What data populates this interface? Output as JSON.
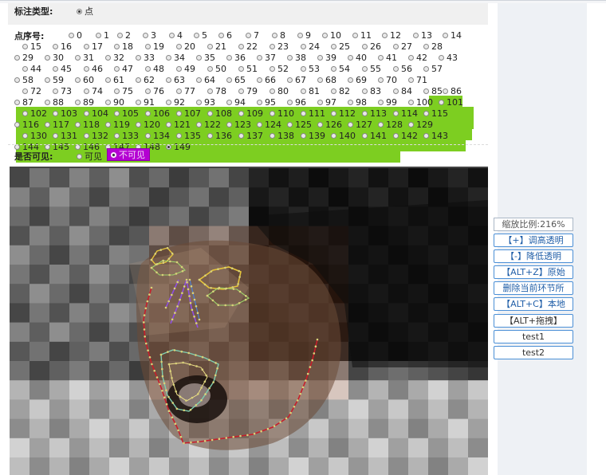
{
  "annotation_type": {
    "label": "标注类型:",
    "options": [
      "点"
    ],
    "selected": "点"
  },
  "point_order": {
    "label": "点序号:",
    "selected": "149",
    "highlight_color": "#7dce21",
    "points": [
      "0",
      "1",
      "2",
      "3",
      "4",
      "5",
      "6",
      "7",
      "8",
      "9",
      "10",
      "11",
      "12",
      "13",
      "14",
      "15",
      "16",
      "17",
      "18",
      "19",
      "20",
      "21",
      "22",
      "23",
      "24",
      "25",
      "26",
      "27",
      "28",
      "29",
      "30",
      "31",
      "32",
      "33",
      "34",
      "35",
      "36",
      "37",
      "38",
      "39",
      "40",
      "41",
      "42",
      "43",
      "44",
      "45",
      "46",
      "47",
      "48",
      "49",
      "50",
      "51",
      "52",
      "53",
      "54",
      "55",
      "56",
      "57",
      "58",
      "59",
      "60",
      "61",
      "62",
      "63",
      "64",
      "65",
      "66",
      "67",
      "68",
      "69",
      "70",
      "71",
      "72",
      "73",
      "74",
      "75",
      "76",
      "77",
      "78",
      "79",
      "80",
      "81",
      "82",
      "83",
      "84",
      "85",
      "86",
      "87",
      "88",
      "89",
      "90",
      "91",
      "92",
      "93",
      "94",
      "95",
      "96",
      "97",
      "98",
      "99",
      "100",
      "101",
      "102",
      "103",
      "104",
      "105",
      "106",
      "107",
      "108",
      "109",
      "110",
      "111",
      "112",
      "113",
      "114",
      "115",
      "116",
      "117",
      "118",
      "119",
      "120",
      "121",
      "122",
      "123",
      "124",
      "125",
      "126",
      "127",
      "128",
      "129",
      "130",
      "131",
      "132",
      "133",
      "134",
      "135",
      "136",
      "137",
      "138",
      "139",
      "140",
      "141",
      "142",
      "143",
      "144",
      "145",
      "146",
      "147",
      "148",
      "149"
    ]
  },
  "visibility": {
    "label": "是否可见:",
    "visible_label": "可见",
    "invisible_label": "不可见",
    "selected": "不可见",
    "selected_color": "#b400d2"
  },
  "viewer": {
    "image": "pixelated face photo with facial landmark annotations"
  },
  "side_panel": {
    "zoom_label": "缩放比例:216%",
    "buttons": [
      "【+】调高透明",
      "【-】降低透明",
      "【ALT+Z】原始",
      "删除当前环节所",
      "【ALT+C】本地",
      "【ALT+拖拽】",
      "test1",
      "test2"
    ]
  },
  "colors": {
    "jaw_line": "#c81e2a",
    "brow_line": "#e6c53a",
    "eye_line": "#9fd46a",
    "mouth_line": "#7fd0b0",
    "nose_line": "#8f4fe0"
  }
}
